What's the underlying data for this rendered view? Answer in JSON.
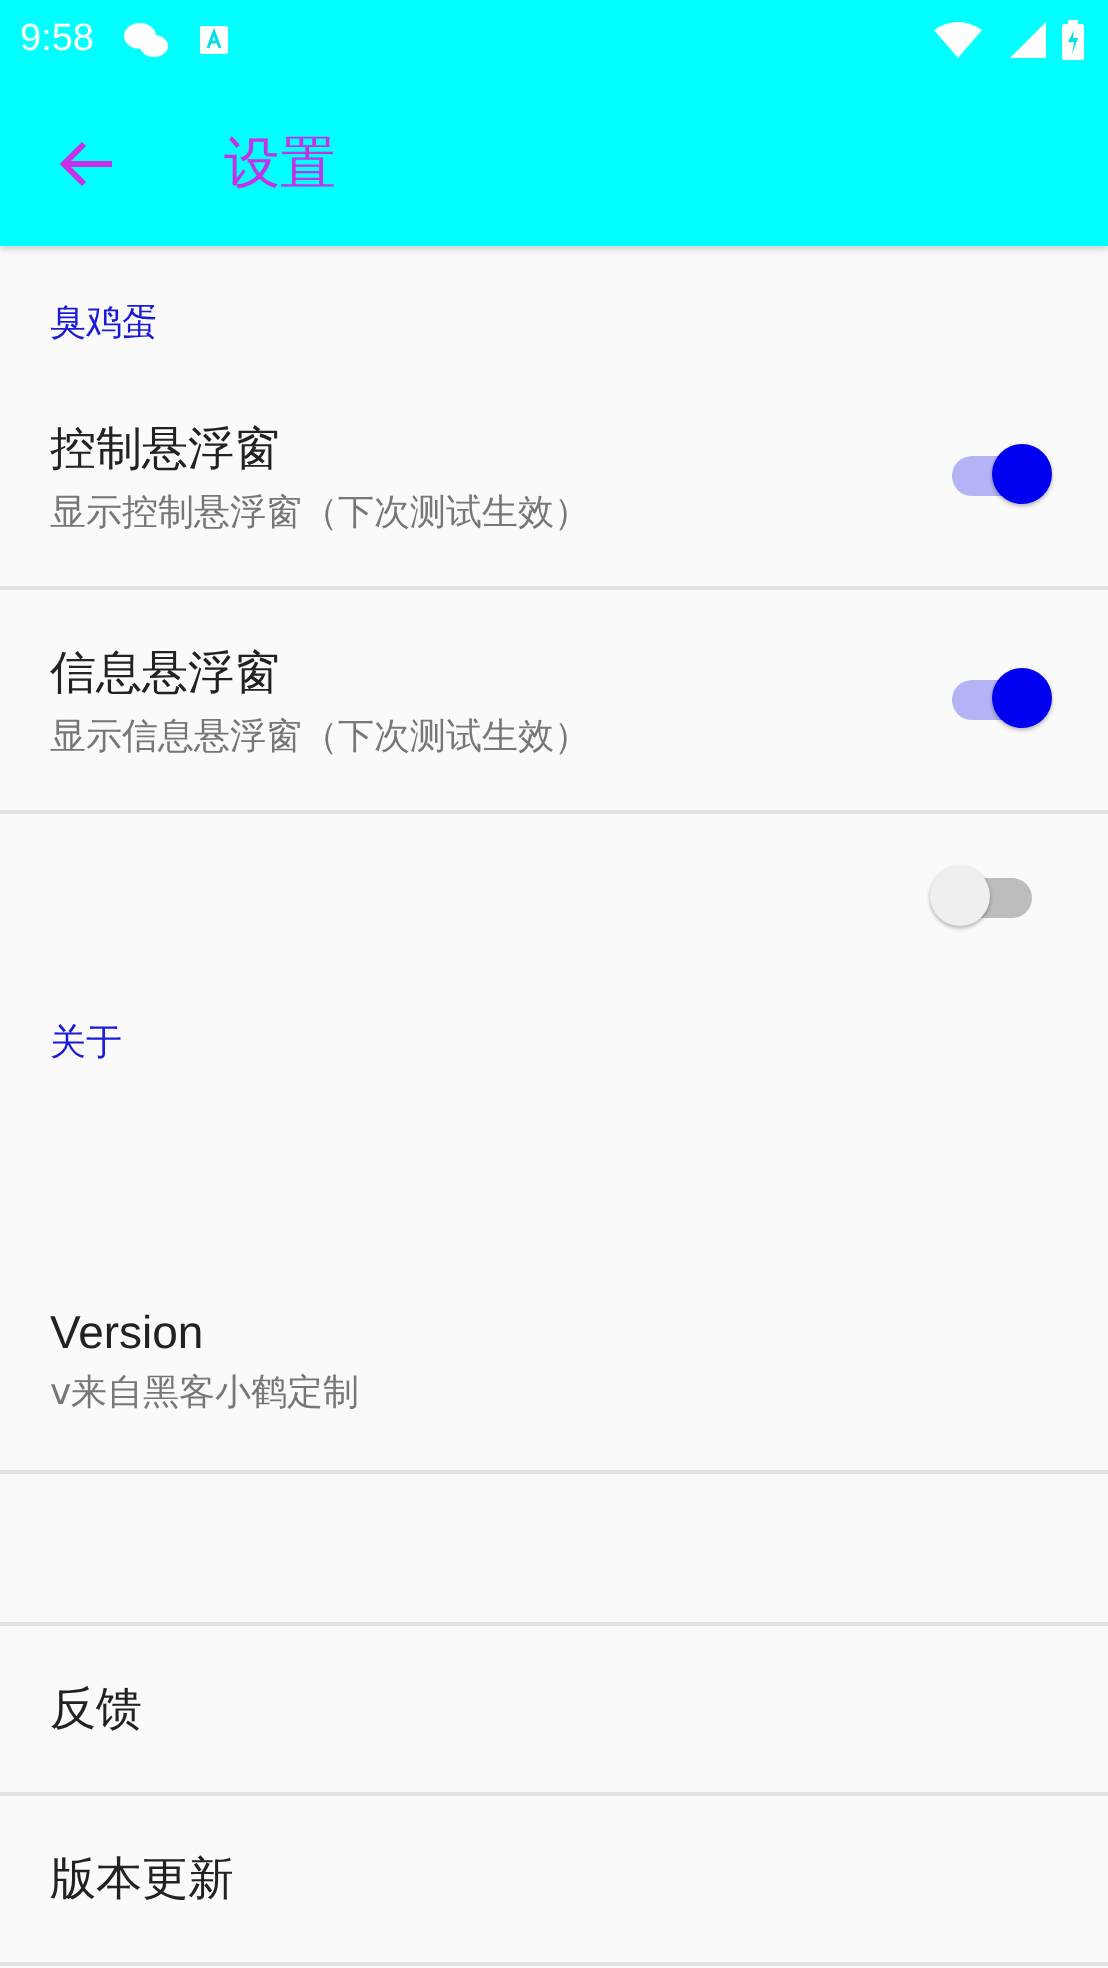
{
  "status_bar": {
    "time": "9:58"
  },
  "toolbar": {
    "title": "设置"
  },
  "items": [
    {
      "kind": "category",
      "title": "臭鸡蛋"
    },
    {
      "kind": "switch",
      "title": "控制悬浮窗",
      "summary": "显示控制悬浮窗（下次测试生效）",
      "on": true
    },
    {
      "kind": "switch",
      "title": "信息悬浮窗",
      "summary": "显示信息悬浮窗（下次测试生效）",
      "on": true
    },
    {
      "kind": "switch",
      "on": false
    },
    {
      "kind": "category",
      "title": "关于"
    },
    {
      "kind": "text",
      "title": "Version",
      "summary": "v来自黑客小鹤定制"
    },
    {
      "kind": "empty"
    },
    {
      "kind": "text",
      "title": "反馈"
    },
    {
      "kind": "text",
      "title": "版本更新"
    }
  ]
}
